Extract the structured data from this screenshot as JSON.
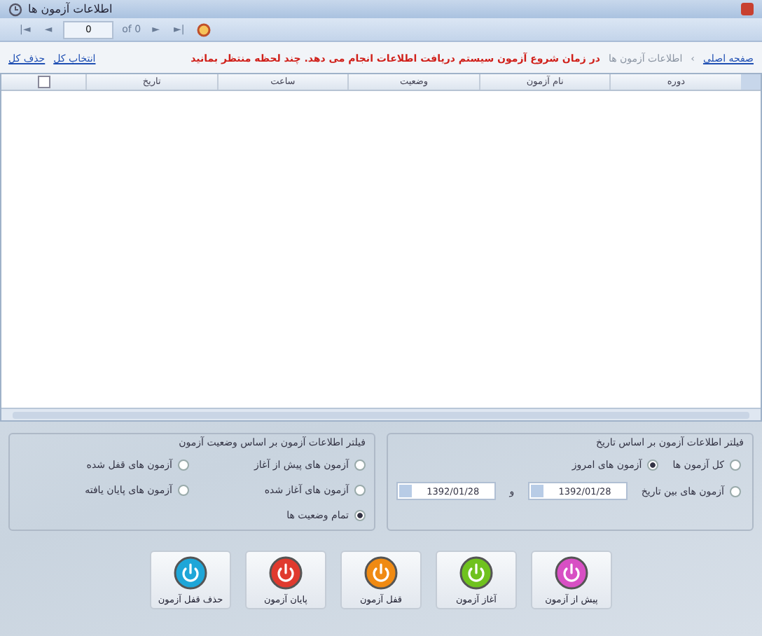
{
  "window": {
    "title": "اطلاعات آزمون ها"
  },
  "pager": {
    "first": "|◄",
    "prev": "◄",
    "page": "0",
    "of": "of 0",
    "next": "►",
    "last": "►|"
  },
  "breadcrumb": {
    "home": "صفحه اصلی",
    "separator": "›",
    "current": "اطلاعات آزمون ها"
  },
  "notice": "در زمان شروع آزمون سیستم دریافت اطلاعات انجام می دهد. چند لحظه منتظر بمانید",
  "links": [
    "انتخاب کل",
    "حذف کل"
  ],
  "table": {
    "columns": [
      "دوره",
      "نام آزمون",
      "وضعیت",
      "ساعت",
      "تاریخ"
    ],
    "select_all": {
      "checked": false
    }
  },
  "date_filter": {
    "title": "فیلتر اطلاعات آزمون بر اساس تاریخ",
    "options": [
      {
        "label": "کل آزمون ها",
        "selected": false
      },
      {
        "label": "آزمون های امروز",
        "selected": true
      }
    ],
    "range": {
      "label": "آزمون های بین تاریخ",
      "selected": false,
      "from": "1392/01/28",
      "and": "و",
      "to": "1392/01/28"
    }
  },
  "status_filter": {
    "title": "فیلتر اطلاعات آزمون بر اساس وضعیت آزمون",
    "options": [
      {
        "label": "آزمون های پیش از آغاز",
        "selected": false
      },
      {
        "label": "آزمون های قفل شده",
        "selected": false
      },
      {
        "label": "آزمون های آغاز شده",
        "selected": false
      },
      {
        "label": "آزمون های پایان یافته",
        "selected": false
      },
      {
        "label": "تمام وضعیت ها",
        "selected": true
      }
    ]
  },
  "actions": [
    {
      "label": "پیش از آزمون",
      "color": "#d84fc4"
    },
    {
      "label": "آغاز آزمون",
      "color": "#6fc21e"
    },
    {
      "label": "قفل آزمون",
      "color": "#f08a12"
    },
    {
      "label": "پایان آزمون",
      "color": "#e03a2e"
    },
    {
      "label": "حذف قفل آزمون",
      "color": "#1ea6d8"
    }
  ]
}
